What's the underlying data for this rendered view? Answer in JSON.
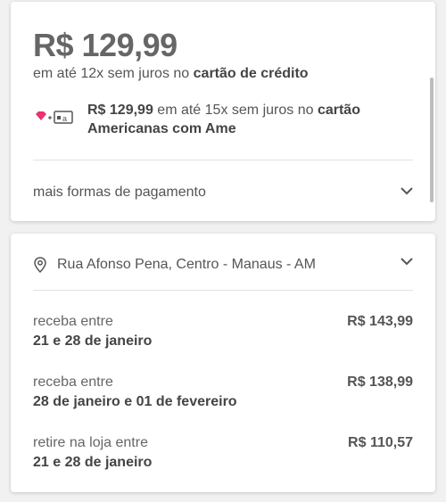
{
  "payment": {
    "price": "R$ 129,99",
    "installments_prefix": "em até 12x sem juros no ",
    "installments_card": "cartão de crédito",
    "ame_price": "R$ 129,99",
    "ame_middle": " em até 15x sem juros no ",
    "ame_card": "cartão Americanas com Ame",
    "ame_icon": "ame-card-icon",
    "more_payment_label": "mais formas de pagamento"
  },
  "shipping": {
    "address": "Rua Afonso Pena, Centro - Manaus - AM",
    "options": [
      {
        "label": "receba entre",
        "date": "21 e 28 de janeiro",
        "price": "R$ 143,99"
      },
      {
        "label": "receba entre",
        "date": "28 de janeiro e 01 de fevereiro",
        "price": "R$ 138,99"
      },
      {
        "label": "retire na loja entre",
        "date": "21 e 28 de janeiro",
        "price": "R$ 110,57"
      }
    ]
  },
  "colors": {
    "ame_pink": "#e8336f",
    "text": "#555555"
  }
}
